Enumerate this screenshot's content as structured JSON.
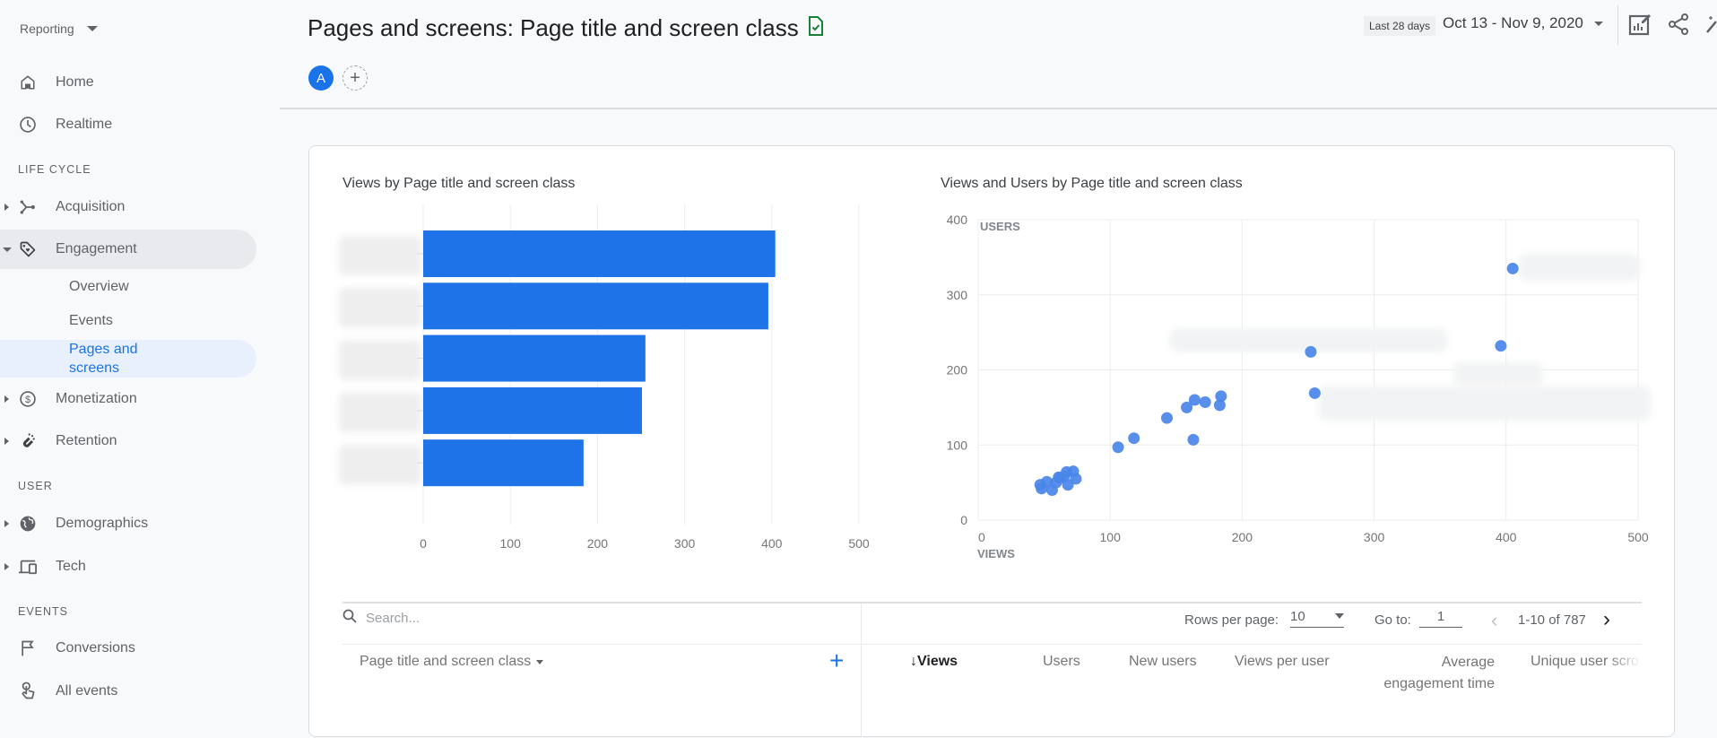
{
  "sidebar": {
    "reporting_label": "Reporting",
    "top_items": [
      {
        "label": "Home",
        "icon": "home-icon"
      },
      {
        "label": "Realtime",
        "icon": "clock-icon"
      }
    ],
    "sections": [
      {
        "title": "LIFE CYCLE"
      },
      {
        "title": "USER"
      },
      {
        "title": "EVENTS"
      }
    ],
    "lifecycle_items": [
      {
        "label": "Acquisition",
        "icon": "acquisition-icon",
        "expanded": false
      },
      {
        "label": "Engagement",
        "icon": "tag-icon",
        "expanded": true
      },
      {
        "label": "Monetization",
        "icon": "dollar-icon",
        "expanded": false
      },
      {
        "label": "Retention",
        "icon": "magnet-icon",
        "expanded": false
      }
    ],
    "engagement_subitems": [
      {
        "label": "Overview"
      },
      {
        "label": "Events"
      },
      {
        "label": "Pages and screens",
        "line1": "Pages and",
        "line2": "screens",
        "selected": true
      }
    ],
    "user_items": [
      {
        "label": "Demographics",
        "icon": "globe-icon"
      },
      {
        "label": "Tech",
        "icon": "devices-icon"
      }
    ],
    "events_items": [
      {
        "label": "Conversions",
        "icon": "flag-icon"
      },
      {
        "label": "All events",
        "icon": "touch-icon"
      }
    ]
  },
  "header": {
    "title": "Pages and screens: Page title and screen class",
    "avatar_letter": "A",
    "add_comparison": "+",
    "date_chip": "Last 28 days",
    "date_range": "Oct 13 - Nov 9, 2020"
  },
  "colors": {
    "accent": "#1a73e8",
    "bar": "#1e73e8",
    "point": "#4a86e8",
    "saved_icon": "#188038"
  },
  "chart_data": [
    {
      "type": "bar",
      "orientation": "horizontal",
      "title": "Views by Page title and screen class",
      "categories": [
        "(redacted 1)",
        "(redacted 2)",
        "(redacted 3)",
        "(redacted 4)",
        "(redacted 5)"
      ],
      "values": [
        404,
        396,
        255,
        251,
        184
      ],
      "xlim": [
        0,
        500
      ],
      "xticks": [
        "0",
        "100",
        "200",
        "300",
        "400",
        "500"
      ],
      "grid": true
    },
    {
      "type": "scatter",
      "title": "Views and Users by Page title and screen class",
      "xlabel": "VIEWS",
      "ylabel": "USERS",
      "xlim": [
        0,
        500
      ],
      "ylim": [
        0,
        400
      ],
      "xticks": [
        "0",
        "100",
        "200",
        "300",
        "400",
        "500"
      ],
      "yticks": [
        "0",
        "100",
        "200",
        "300",
        "400"
      ],
      "grid": true,
      "points": [
        {
          "x": 405,
          "y": 335
        },
        {
          "x": 396,
          "y": 232
        },
        {
          "x": 252,
          "y": 224
        },
        {
          "x": 255,
          "y": 169
        },
        {
          "x": 184,
          "y": 165
        },
        {
          "x": 183,
          "y": 153
        },
        {
          "x": 172,
          "y": 157
        },
        {
          "x": 164,
          "y": 160
        },
        {
          "x": 158,
          "y": 150
        },
        {
          "x": 143,
          "y": 136
        },
        {
          "x": 163,
          "y": 107
        },
        {
          "x": 118,
          "y": 109
        },
        {
          "x": 106,
          "y": 97
        },
        {
          "x": 72,
          "y": 65
        },
        {
          "x": 67,
          "y": 64
        },
        {
          "x": 74,
          "y": 55
        },
        {
          "x": 68,
          "y": 47
        },
        {
          "x": 65,
          "y": 58
        },
        {
          "x": 61,
          "y": 57
        },
        {
          "x": 62,
          "y": 56
        },
        {
          "x": 59,
          "y": 50
        },
        {
          "x": 56,
          "y": 40
        },
        {
          "x": 52,
          "y": 51
        },
        {
          "x": 48,
          "y": 42
        },
        {
          "x": 47,
          "y": 47
        }
      ],
      "point_labels_redacted": 5
    }
  ],
  "table": {
    "search_placeholder": "Search...",
    "rows_per_page_label": "Rows per page:",
    "rows_per_page_value": "10",
    "goto_label": "Go to:",
    "goto_value": "1",
    "range_text": "1-10 of 787",
    "dimension_header": "Page title and screen class",
    "add_dimension": "+",
    "columns": [
      {
        "label": "Views",
        "sorted": "desc"
      },
      {
        "label": "Users"
      },
      {
        "label": "New users"
      },
      {
        "label": "Views per user"
      },
      {
        "label": "Average engagement time",
        "line1": "Average",
        "line2": "engagement time"
      },
      {
        "label": "Unique user scro"
      }
    ]
  }
}
